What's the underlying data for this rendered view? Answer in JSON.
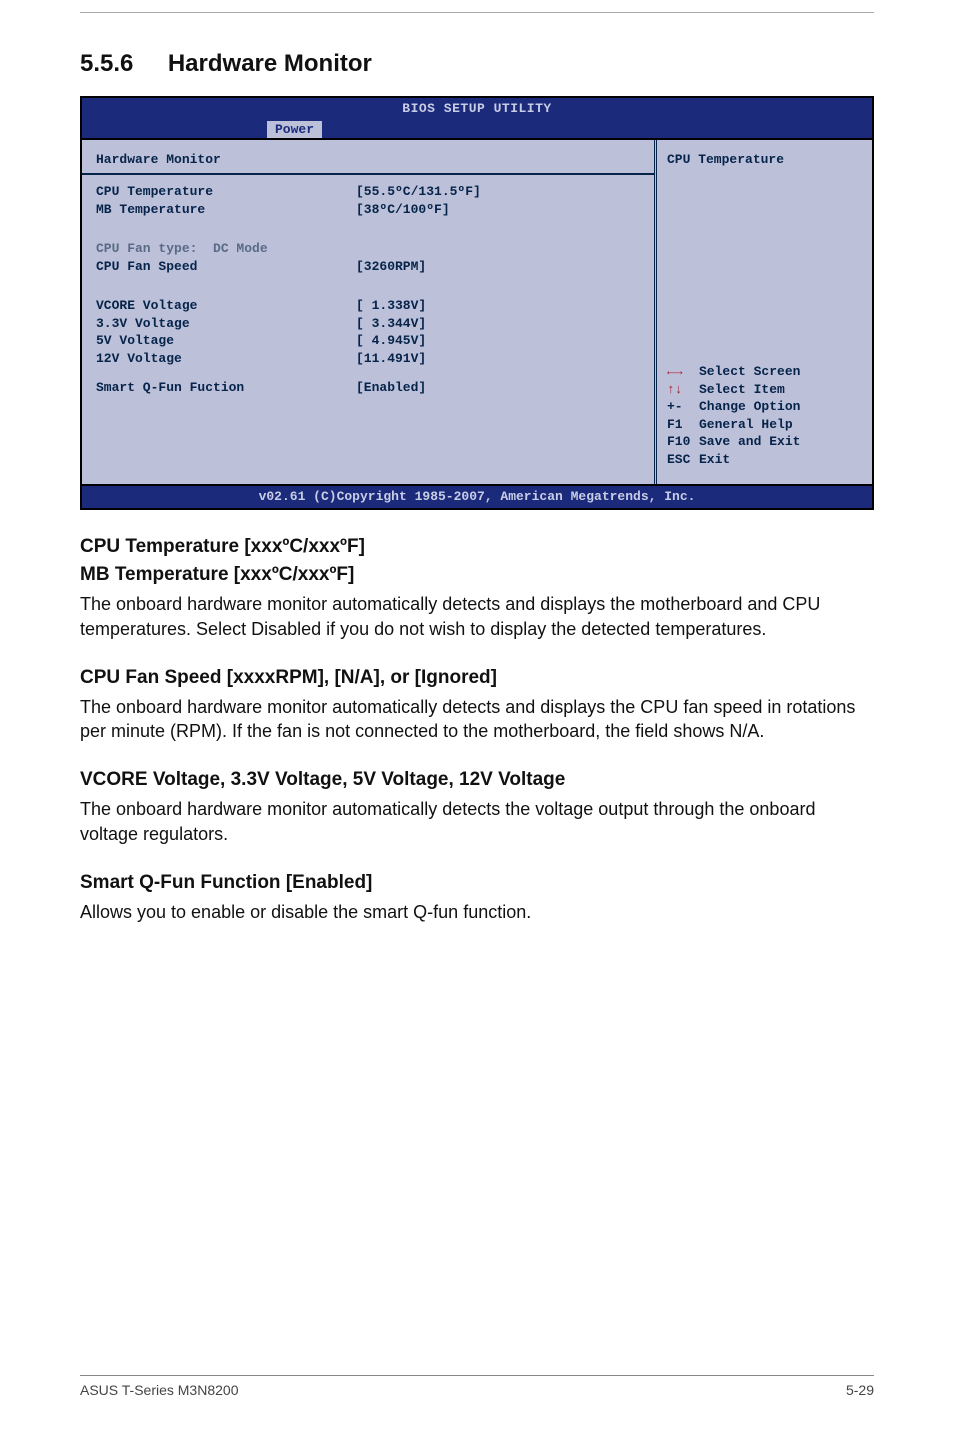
{
  "section": {
    "number": "5.5.6",
    "title": "Hardware Monitor"
  },
  "bios": {
    "title": "BIOS SETUP UTILITY",
    "active_tab": "Power",
    "left": {
      "header": "Hardware Monitor",
      "rows": [
        {
          "label": "CPU Temperature",
          "value": "[55.5ºC/131.5ºF]",
          "faded": false
        },
        {
          "label": "MB Temperature",
          "value": "[38ºC/100ºF]",
          "faded": false
        },
        {
          "gap": true
        },
        {
          "label": "CPU Fan type:  DC Mode",
          "value": "",
          "faded": true
        },
        {
          "label": "CPU Fan Speed",
          "value": "[3260RPM]",
          "faded": false
        },
        {
          "gap": true
        },
        {
          "label": "VCORE Voltage",
          "value": "[ 1.338V]",
          "faded": false
        },
        {
          "label": "3.3V Voltage",
          "value": "[ 3.344V]",
          "faded": false
        },
        {
          "label": "5V Voltage",
          "value": "[ 4.945V]",
          "faded": false
        },
        {
          "label": "12V Voltage",
          "value": "[11.491V]",
          "faded": false
        },
        {
          "smallgap": true
        },
        {
          "label": "Smart Q-Fun Fuction",
          "value": "[Enabled]",
          "faded": false
        }
      ]
    },
    "right": {
      "header": "CPU Temperature",
      "help": [
        {
          "key": "lr",
          "text": "Select Screen"
        },
        {
          "key": "ud",
          "text": "Select Item"
        },
        {
          "key": "+-",
          "text": "Change Option"
        },
        {
          "key": "F1",
          "text": "General Help"
        },
        {
          "key": "F10",
          "text": "Save and Exit"
        },
        {
          "key": "ESC",
          "text": "Exit"
        }
      ]
    },
    "footer": "v02.61 (C)Copyright 1985-2007, American Megatrends, Inc."
  },
  "content": {
    "h1a": "CPU Temperature [xxxºC/xxxºF]",
    "h1b": "MB Temperature [xxxºC/xxxºF]",
    "p1": "The onboard hardware monitor automatically detects and displays the motherboard and CPU temperatures. Select Disabled if you do not wish to display the detected temperatures.",
    "h2": "CPU Fan Speed [xxxxRPM], [N/A], or [Ignored]",
    "p2": "The onboard hardware monitor automatically detects and displays the CPU fan speed in rotations per minute (RPM). If the fan is not connected to the motherboard, the field shows N/A.",
    "h3": "VCORE Voltage, 3.3V Voltage, 5V Voltage, 12V Voltage",
    "p3": "The onboard hardware monitor automatically detects the voltage output through the onboard voltage regulators.",
    "h4": "Smart Q-Fun Function [Enabled]",
    "p4": "Allows you to enable or disable the smart Q-fun function."
  },
  "footer": {
    "left": "ASUS T-Series M3N8200",
    "right": "5-29"
  }
}
